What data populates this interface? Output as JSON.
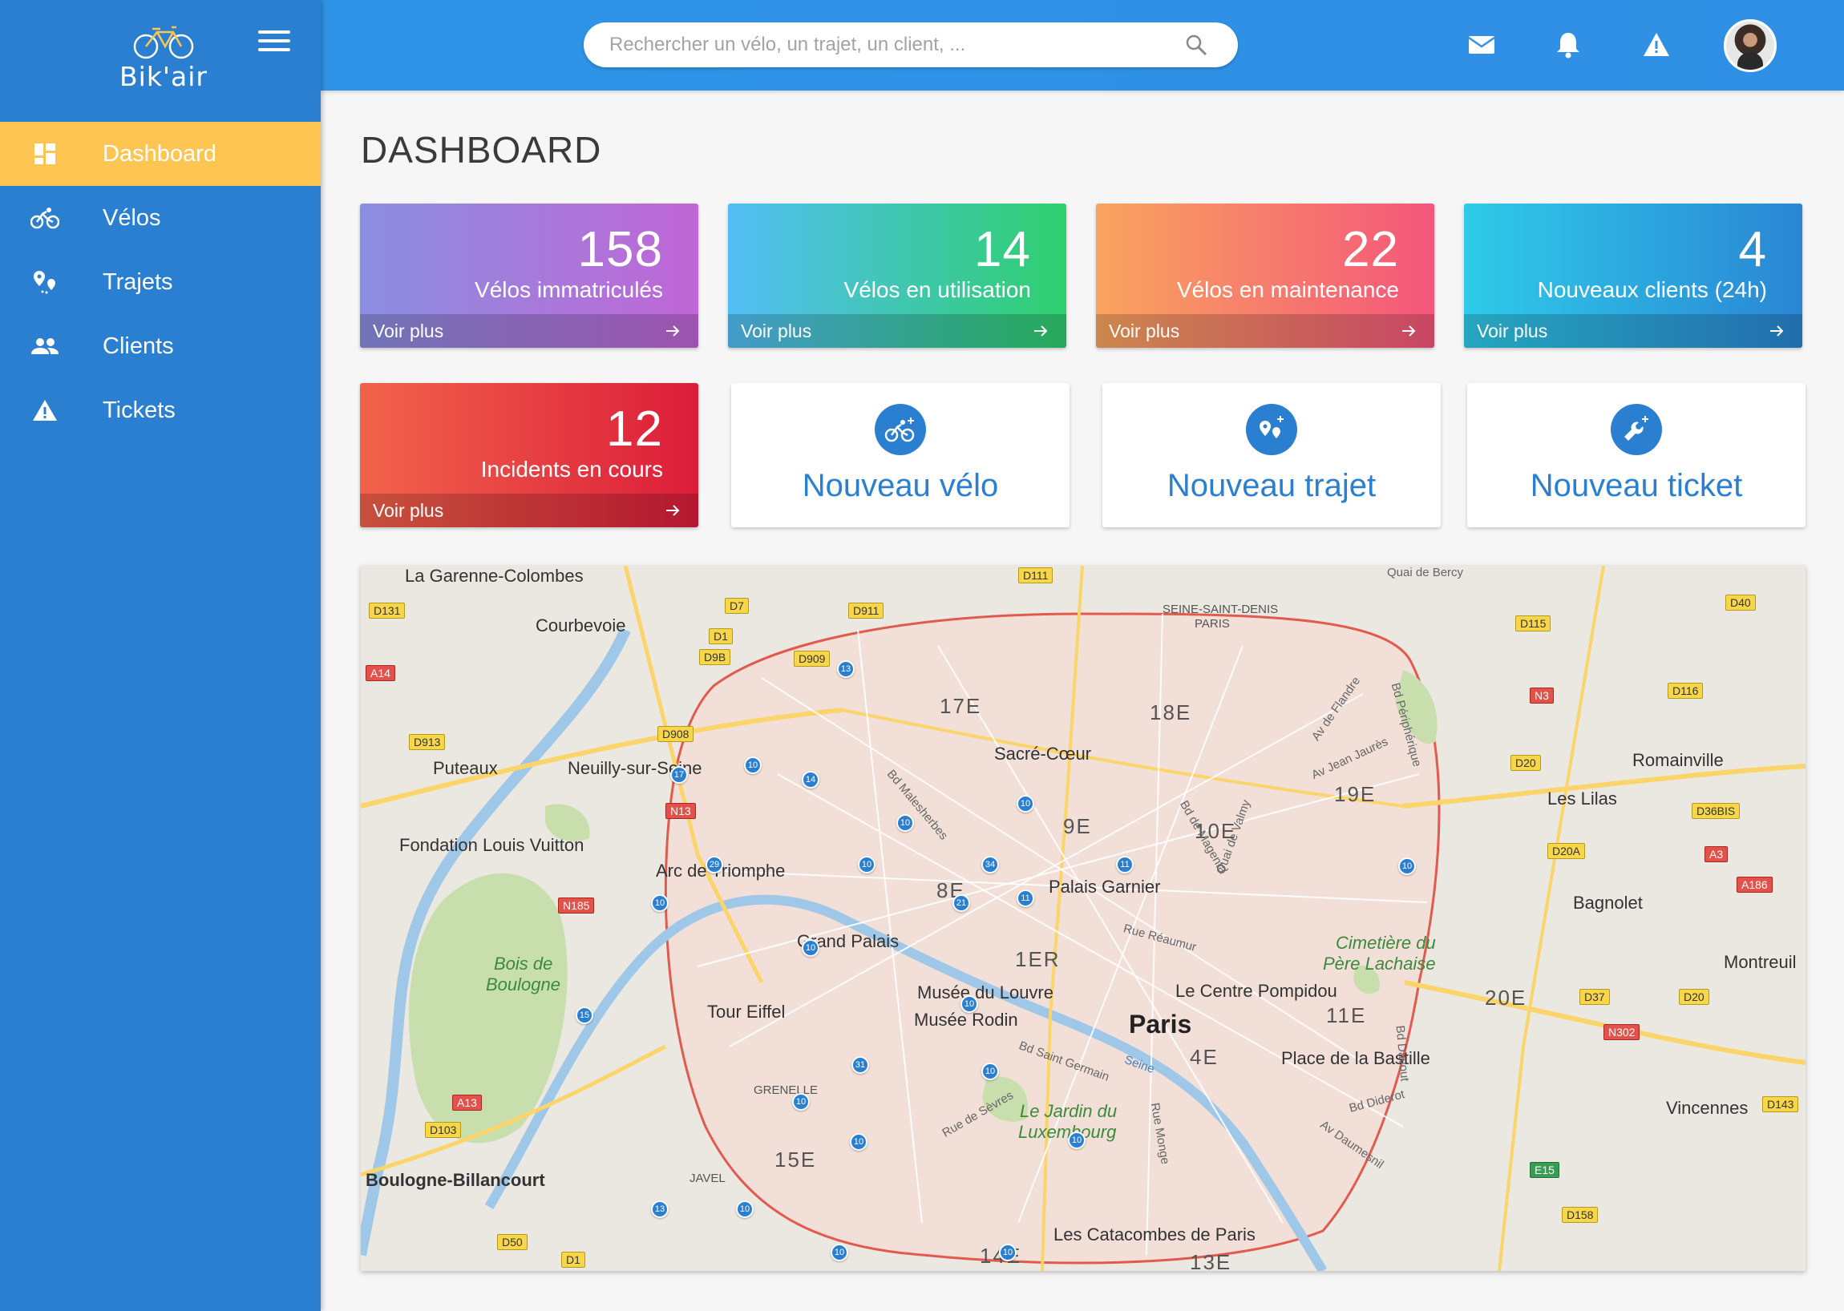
{
  "app": {
    "name": "Bik'air"
  },
  "sidebar": {
    "items": [
      {
        "label": "Dashboard",
        "icon": "dashboard-icon",
        "active": true
      },
      {
        "label": "Vélos",
        "icon": "bike-icon"
      },
      {
        "label": "Trajets",
        "icon": "route-pins-icon"
      },
      {
        "label": "Clients",
        "icon": "people-icon"
      },
      {
        "label": "Tickets",
        "icon": "warning-icon"
      }
    ]
  },
  "header": {
    "search_placeholder": "Rechercher un vélo, un trajet, un client, ...",
    "icons": [
      "mail-icon",
      "bell-icon",
      "alert-icon"
    ]
  },
  "main": {
    "title": "DASHBOARD",
    "stats": [
      {
        "value": "158",
        "label": "Vélos immatriculés",
        "link": "Voir plus"
      },
      {
        "value": "14",
        "label": "Vélos en utilisation",
        "link": "Voir plus"
      },
      {
        "value": "22",
        "label": "Vélos en maintenance",
        "link": "Voir plus"
      },
      {
        "value": "4",
        "label": "Nouveaux clients (24h)",
        "link": "Voir plus"
      },
      {
        "value": "12",
        "label": "Incidents en cours",
        "link": "Voir plus"
      }
    ],
    "actions": [
      {
        "label": "Nouveau vélo",
        "icon": "add-bike-icon"
      },
      {
        "label": "Nouveau trajet",
        "icon": "add-route-icon"
      },
      {
        "label": "Nouveau ticket",
        "icon": "add-ticket-wrench-icon"
      }
    ]
  },
  "map": {
    "places": [
      "La Garenne-Colombes",
      "Courbevoie",
      "Puteaux",
      "Neuilly-sur-Seine",
      "Fondation Louis Vuitton",
      "Arc de Triomphe",
      "Bois de",
      "Boulogne",
      "Grand Palais",
      "Tour Eiffel",
      "Musée du Louvre",
      "Musée Rodin",
      "Paris",
      "Sacré-Cœur",
      "Palais Garnier",
      "Le Centre Pompidou",
      "Place de la Bastille",
      "Cimetière du",
      "Père Lachaise",
      "Le Jardin du",
      "Luxembourg",
      "Les Catacombes de Paris",
      "Boulogne-Billancourt",
      "Romainville",
      "Les Lilas",
      "Bagnolet",
      "Montreuil",
      "Vincennes",
      "SEINE-SAINT-DENIS",
      "PARIS",
      "GRENELLE",
      "JAVEL"
    ],
    "districts": [
      "17E",
      "18E",
      "19E",
      "9E",
      "10E",
      "8E",
      "1ER",
      "11E",
      "4E",
      "20E",
      "15E",
      "14E",
      "13E"
    ],
    "roads": [
      "D131",
      "A14",
      "D913",
      "D7",
      "D1",
      "D9B",
      "D909",
      "D911",
      "D111",
      "D908",
      "N13",
      "N185",
      "A13",
      "D103",
      "D50",
      "D1",
      "D115",
      "D40",
      "N3",
      "D116",
      "D20",
      "D36BIS",
      "D20A",
      "A3",
      "A186",
      "D37",
      "D20",
      "N302",
      "D143",
      "E15",
      "D158"
    ],
    "streets": [
      "Bd Malesherbes",
      "Bd de Magenta",
      "Av de Flandre",
      "Av Jean Jaurès",
      "Bd Périphérique",
      "Rue Réaumur",
      "Bd Saint Germain",
      "Rue de Sèvres",
      "Rue Monge",
      "Bd Diderot",
      "Av Daumesnil",
      "Quai de Bercy",
      "Bd Davout",
      "Quai de Valmy",
      "Seine"
    ],
    "markers": [
      "13",
      "17",
      "10",
      "14",
      "10",
      "29",
      "10",
      "34",
      "10",
      "21",
      "10",
      "10",
      "11",
      "11",
      "15",
      "10",
      "31",
      "10",
      "10",
      "10",
      "10",
      "13",
      "10",
      "10",
      "10",
      "10"
    ]
  }
}
